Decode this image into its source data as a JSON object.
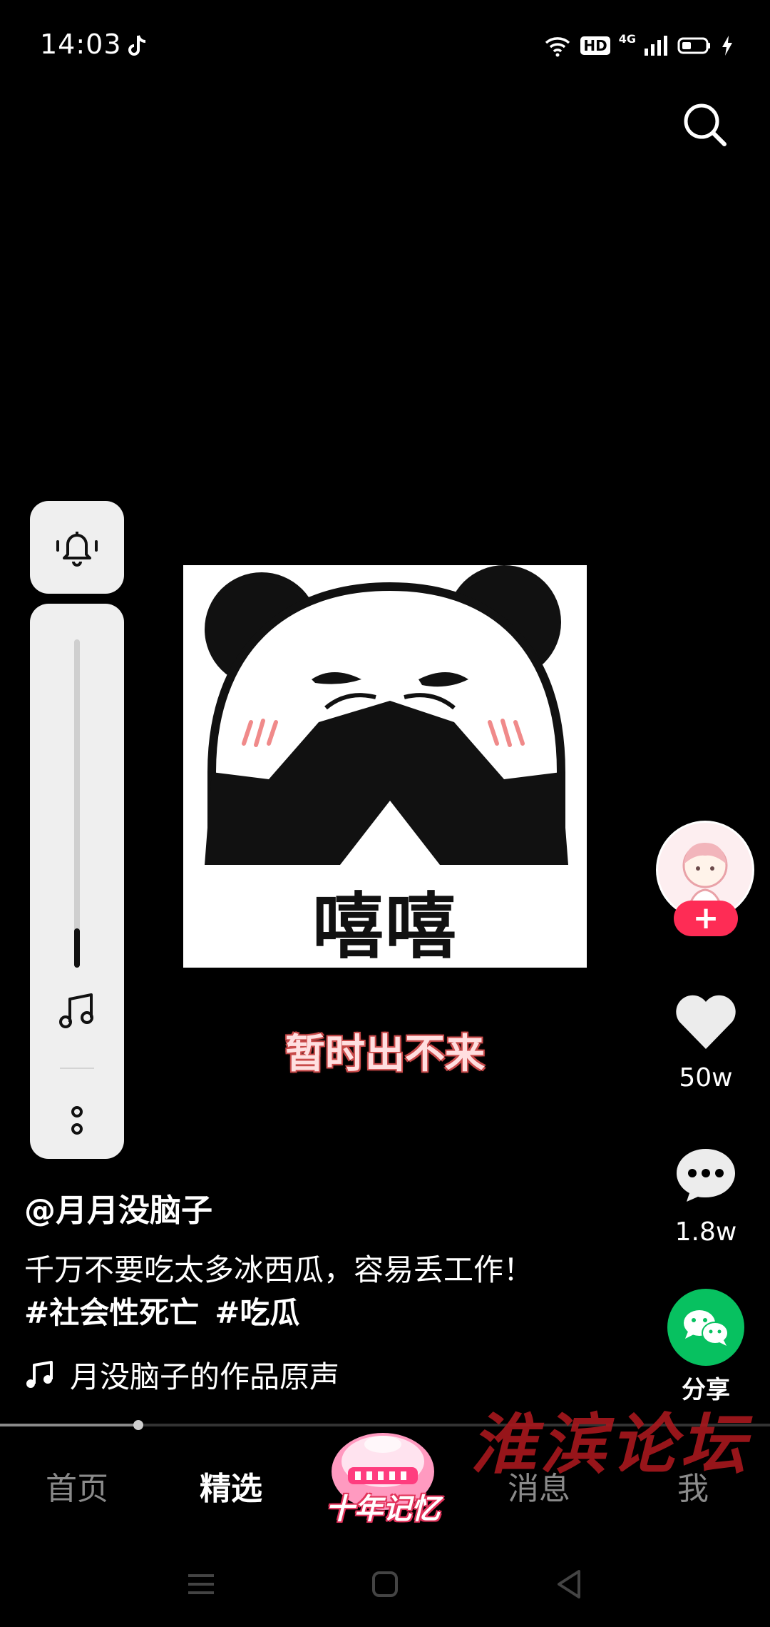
{
  "status_bar": {
    "time": "14:03",
    "app_icon": "tiktok-icon",
    "hd_badge": "HD",
    "network": "4G"
  },
  "volume_panel": {
    "bell_icon": "bell-icon",
    "music_icon": "music-note-icon",
    "more_icon": "more-vertical-icon",
    "level": 0.12
  },
  "video": {
    "meme_caption": "嘻嘻",
    "subtitle": "暂时出不来"
  },
  "actions": {
    "like_count": "50w",
    "comment_count": "1.8w",
    "share_label": "分享",
    "follow_label": "+"
  },
  "post": {
    "username": "@月月没脑子",
    "description": "千万不要吃太多冰西瓜，容易丢工作！",
    "hashtags": [
      "#社会性死亡",
      "#吃瓜"
    ],
    "music": "月没脑子的作品原声"
  },
  "progress": {
    "fraction": 0.18
  },
  "watermark": "淮滨论坛",
  "nav": {
    "home": "首页",
    "featured": "精选",
    "center_badge": "十年记忆",
    "messages": "消息",
    "me": "我"
  },
  "colors": {
    "accent_red": "#fe2c55",
    "wechat_green": "#07c160"
  }
}
